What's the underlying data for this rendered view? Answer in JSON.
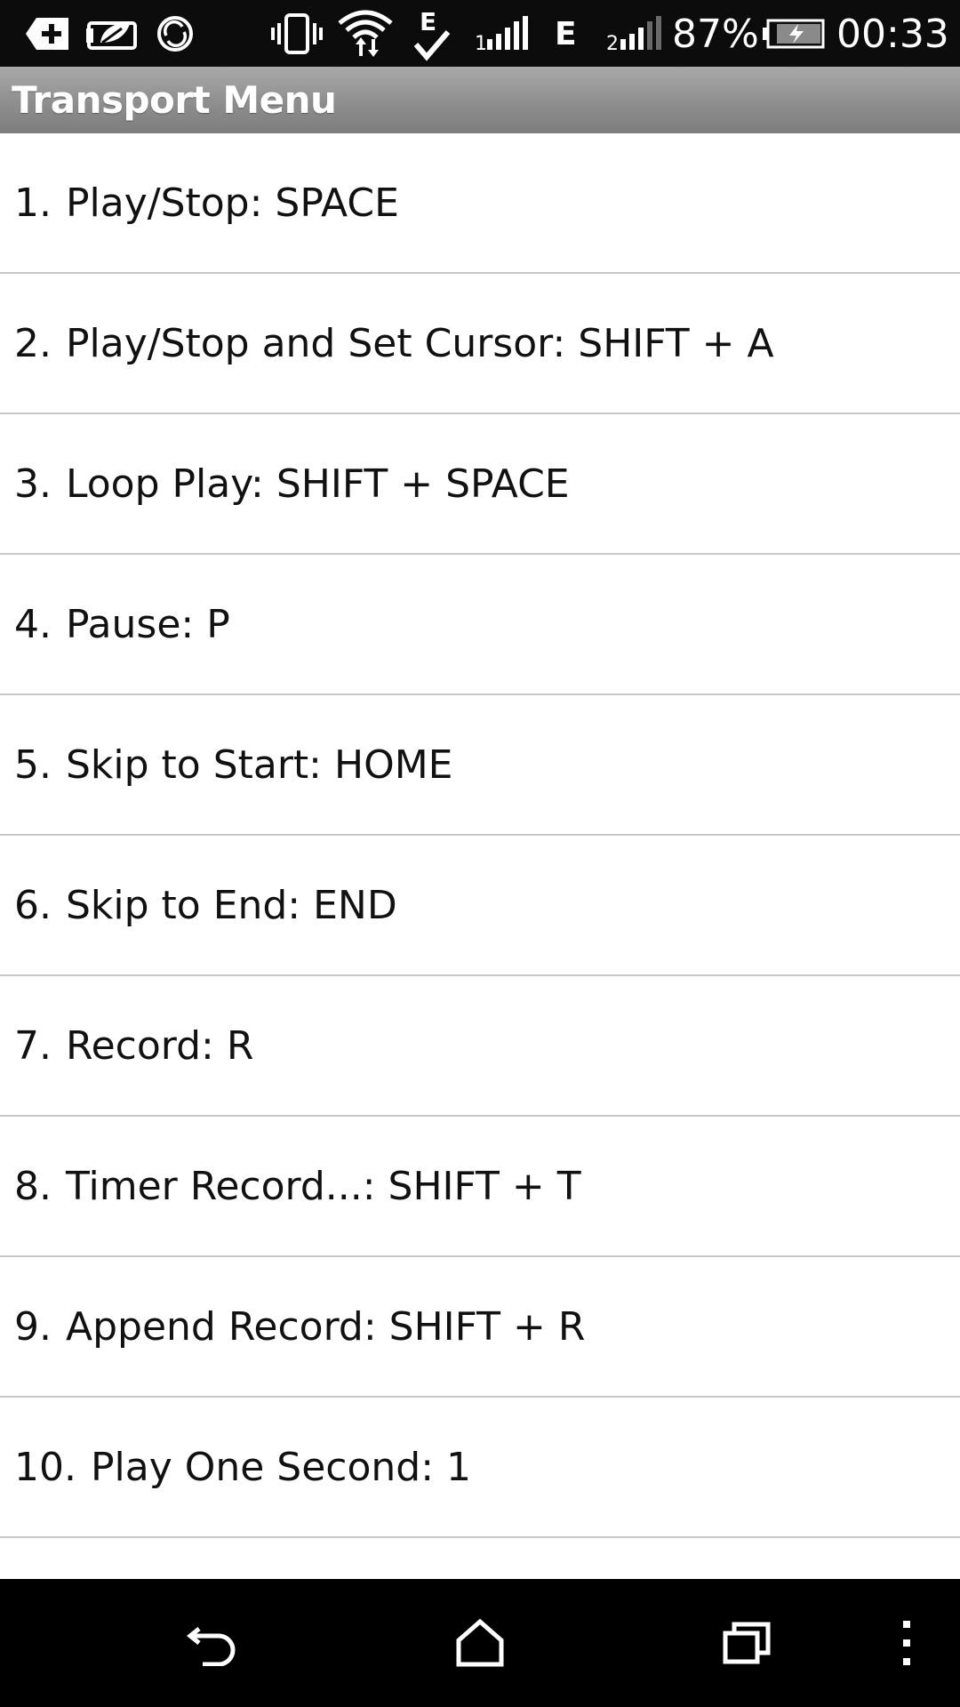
{
  "status_bar": {
    "battery_percent": "87%",
    "time": "00:33",
    "network_label_1": "E",
    "network_label_2": "E",
    "icons": [
      "add-box-icon",
      "leaf-card-icon",
      "sync-circle-icon",
      "vibrate-icon",
      "wifi-icon",
      "data-check-icon",
      "signal-icon",
      "edge-signal-icon",
      "battery-charging-icon"
    ]
  },
  "title_bar": {
    "title": "Transport Menu"
  },
  "menu": {
    "items": [
      {
        "num": "1.",
        "label": "Play/Stop: SPACE"
      },
      {
        "num": "2.",
        "label": "Play/Stop and Set Cursor: SHIFT + A"
      },
      {
        "num": "3.",
        "label": "Loop Play: SHIFT + SPACE"
      },
      {
        "num": "4.",
        "label": "Pause: P"
      },
      {
        "num": "5.",
        "label": "Skip to Start: HOME"
      },
      {
        "num": "6.",
        "label": "Skip to End: END"
      },
      {
        "num": "7.",
        "label": "Record: R"
      },
      {
        "num": "8.",
        "label": "Timer Record...: SHIFT + T"
      },
      {
        "num": "9.",
        "label": "Append Record: SHIFT + R"
      },
      {
        "num": "10.",
        "label": "Play One Second: 1"
      }
    ]
  },
  "nav_bar": {
    "buttons": [
      "back-icon",
      "home-icon",
      "recent-apps-icon",
      "overflow-menu-icon"
    ]
  },
  "colors": {
    "status_bar_bg": "#0c0c0c",
    "title_gradient_top": "#a9a9a9",
    "title_gradient_bottom": "#7d7d7d",
    "divider": "#c8c8c8",
    "nav_bar_bg": "#000000",
    "text": "#111111"
  }
}
